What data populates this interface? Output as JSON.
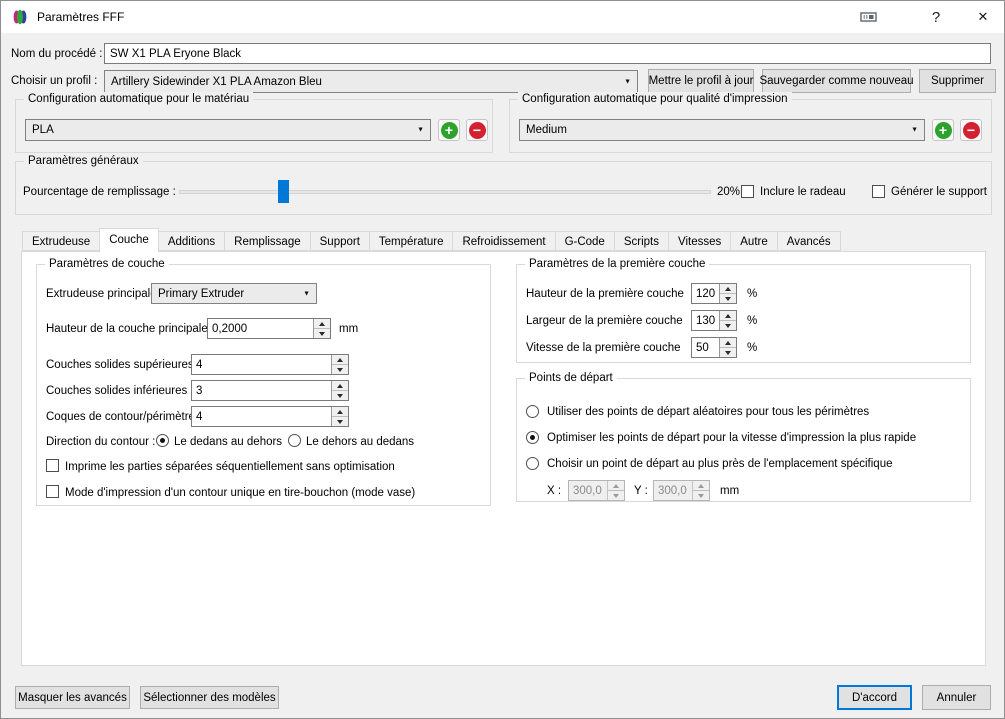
{
  "window": {
    "title": "Paramètres FFF",
    "help_label": "?",
    "close_label": "✕"
  },
  "header": {
    "process_name_label": "Nom du procédé :",
    "process_name_value": "SW X1 PLA Eryone Black",
    "profile_label": "Choisir un profil :",
    "profile_value": "Artillery Sidewinder X1 PLA Amazon Bleu",
    "update_profile": "Mettre le profil à jour",
    "save_as_new": "Sauvegarder comme nouveau",
    "delete": "Supprimer"
  },
  "auto_config": {
    "material_title": "Configuration automatique pour le matériau",
    "material_value": "PLA",
    "quality_title": "Configuration automatique pour qualité d'impression",
    "quality_value": "Medium"
  },
  "general": {
    "title": "Paramètres généraux",
    "infill_label": "Pourcentage de remplissage :",
    "infill_percent": 20,
    "infill_display": "20%",
    "raft_label": "Inclure le radeau",
    "raft_checked": false,
    "support_label": "Générer le support",
    "support_checked": false
  },
  "tabs": {
    "selected": "Couche",
    "items": [
      {
        "label": "Extrudeuse"
      },
      {
        "label": "Couche"
      },
      {
        "label": "Additions"
      },
      {
        "label": "Remplissage"
      },
      {
        "label": "Support"
      },
      {
        "label": "Température"
      },
      {
        "label": "Refroidissement"
      },
      {
        "label": "G-Code"
      },
      {
        "label": "Scripts"
      },
      {
        "label": "Vitesses"
      },
      {
        "label": "Autre"
      },
      {
        "label": "Avancés"
      }
    ]
  },
  "layer_settings": {
    "title": "Paramètres de couche",
    "primary_extruder_label": "Extrudeuse principale",
    "primary_extruder_value": "Primary Extruder",
    "layer_height_label": "Hauteur de la couche principale",
    "layer_height_value": "0,2000",
    "layer_height_unit": "mm",
    "top_layers_label": "Couches solides supérieures",
    "top_layers_value": "4",
    "bottom_layers_label": "Couches solides inférieures",
    "bottom_layers_value": "3",
    "perimeter_shells_label": "Coques de contour/périmètre",
    "perimeter_shells_value": "4",
    "outline_direction_label": "Direction du contour :",
    "outline_inside_out": "Le dedans au dehors",
    "outline_outside_in": "Le dehors au dedans",
    "outline_selected": "Le dedans au dehors",
    "sequential_printing_label": "Imprime les parties séparées séquentiellement sans optimisation",
    "sequential_printing_checked": false,
    "vase_mode_label": "Mode d'impression d'un contour unique en tire-bouchon (mode vase)",
    "vase_mode_checked": false
  },
  "first_layer": {
    "title": "Paramètres de la première couche",
    "height_label": "Hauteur de la première couche",
    "height_value": "120",
    "height_unit": "%",
    "width_label": "Largeur de la première couche",
    "width_value": "130",
    "width_unit": "%",
    "speed_label": "Vitesse de la première couche",
    "speed_value": "50",
    "speed_unit": "%"
  },
  "start_points": {
    "title": "Points de départ",
    "option_random": "Utiliser des points de départ aléatoires pour tous les périmètres",
    "option_optimize": "Optimiser les points de départ pour la vitesse d'impression la plus rapide",
    "option_specific": "Choisir un point de départ au plus près de l'emplacement spécifique",
    "selected": "Optimiser les points de départ pour la vitesse d'impression la plus rapide",
    "x_label": "X :",
    "x_value": "300,0",
    "y_label": "Y :",
    "y_value": "300,0",
    "unit": "mm"
  },
  "footer": {
    "hide_advanced": "Masquer les avancés",
    "select_models": "Sélectionner des modèles",
    "ok": "D'accord",
    "cancel": "Annuler"
  },
  "colors": {
    "accent_blue": "#0078d7",
    "add_green": "#2da32d",
    "remove_red": "#d32130",
    "dialog_bg": "#f0f0f0",
    "titlebar_bg": "#ffffff"
  }
}
